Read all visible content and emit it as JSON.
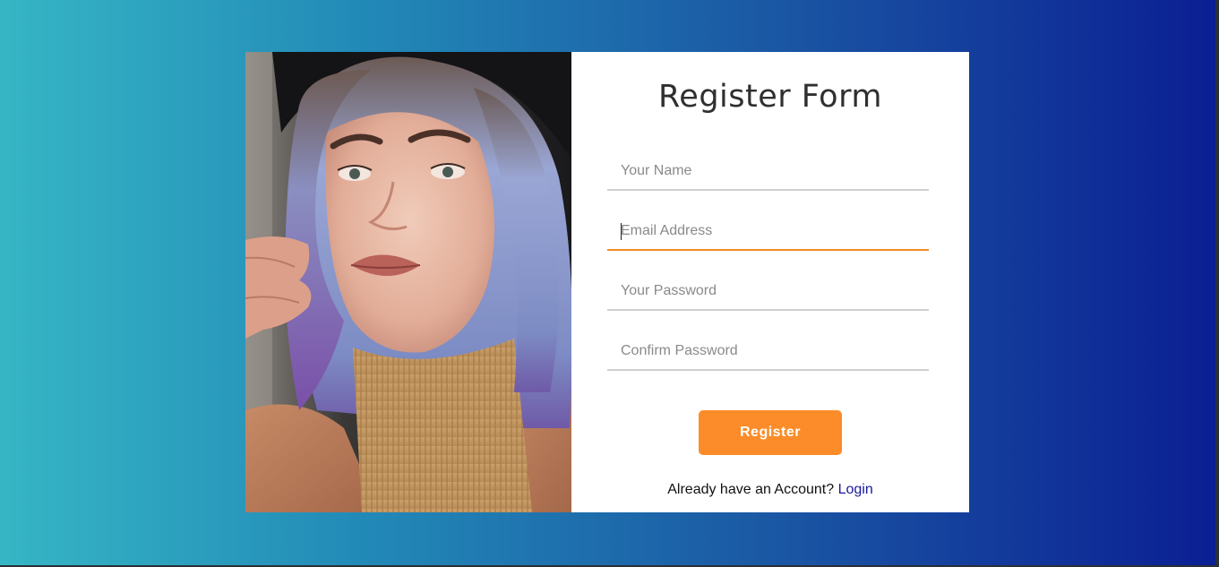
{
  "form": {
    "title": "Register Form",
    "fields": [
      {
        "placeholder": "Your Name",
        "value": ""
      },
      {
        "placeholder": "Email Address",
        "value": ""
      },
      {
        "placeholder": "Your Password",
        "value": ""
      },
      {
        "placeholder": "Confirm Password",
        "value": ""
      }
    ],
    "submit_label": "Register",
    "footer_text": "Already have an Account?",
    "footer_link": "Login"
  },
  "colors": {
    "accent": "#fb8c29",
    "link": "#18189a",
    "gradient_start": "#36b6c5",
    "gradient_end": "#0b1f93"
  }
}
